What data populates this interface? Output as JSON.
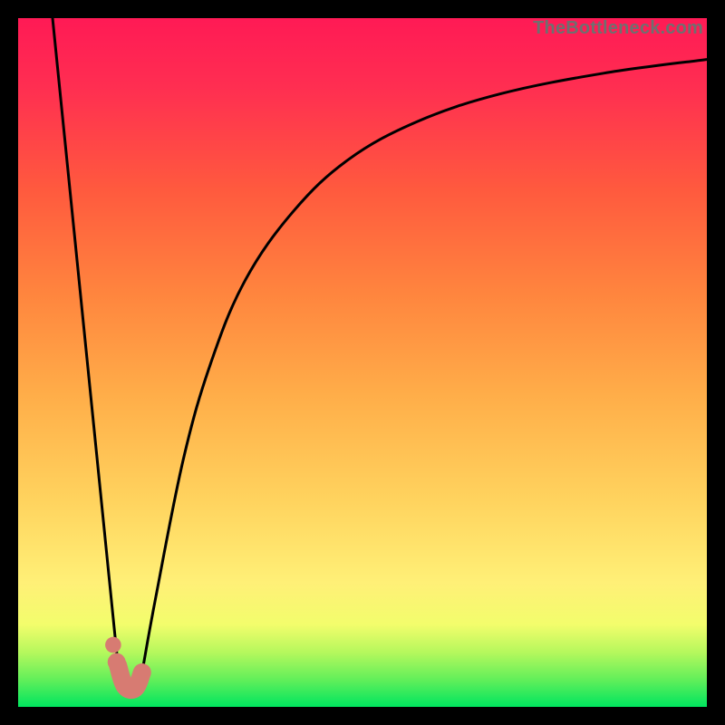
{
  "watermark": "TheBottleneck.com",
  "chart_data": {
    "type": "line",
    "title": "",
    "xlabel": "",
    "ylabel": "",
    "xlim": [
      0,
      100
    ],
    "ylim": [
      0,
      100
    ],
    "gradient_bands": [
      {
        "y": 0,
        "color": "#00e55f"
      },
      {
        "y": 4,
        "color": "#63ef5a"
      },
      {
        "y": 8,
        "color": "#b7f85d"
      },
      {
        "y": 12,
        "color": "#f3fd6c"
      },
      {
        "y": 18,
        "color": "#fff077"
      },
      {
        "y": 30,
        "color": "#ffd35e"
      },
      {
        "y": 45,
        "color": "#ffae49"
      },
      {
        "y": 60,
        "color": "#ff853e"
      },
      {
        "y": 75,
        "color": "#ff5a3e"
      },
      {
        "y": 90,
        "color": "#ff2e51"
      },
      {
        "y": 100,
        "color": "#ff1a55"
      }
    ],
    "series": [
      {
        "name": "left-descent",
        "style": "thin-black",
        "points": [
          {
            "x": 5.0,
            "y": 100.0
          },
          {
            "x": 14.5,
            "y": 6.0
          }
        ]
      },
      {
        "name": "right-curve",
        "style": "thin-black",
        "points": [
          {
            "x": 18.0,
            "y": 5.0
          },
          {
            "x": 20.0,
            "y": 16.0
          },
          {
            "x": 24.0,
            "y": 36.0
          },
          {
            "x": 28.0,
            "y": 50.0
          },
          {
            "x": 33.0,
            "y": 62.0
          },
          {
            "x": 40.0,
            "y": 72.0
          },
          {
            "x": 48.0,
            "y": 79.5
          },
          {
            "x": 58.0,
            "y": 85.0
          },
          {
            "x": 70.0,
            "y": 89.0
          },
          {
            "x": 85.0,
            "y": 92.0
          },
          {
            "x": 100.0,
            "y": 94.0
          }
        ]
      },
      {
        "name": "blob-hook",
        "style": "thick-salmon",
        "points": [
          {
            "x": 14.5,
            "y": 6.0
          },
          {
            "x": 15.5,
            "y": 3.0
          },
          {
            "x": 17.0,
            "y": 2.7
          },
          {
            "x": 18.0,
            "y": 5.0
          }
        ]
      }
    ],
    "dots": [
      {
        "x": 13.8,
        "y": 9.0,
        "r": 1.0,
        "color": "#d77b72"
      },
      {
        "x": 14.3,
        "y": 6.5,
        "r": 1.3,
        "color": "#d77b72"
      }
    ]
  }
}
